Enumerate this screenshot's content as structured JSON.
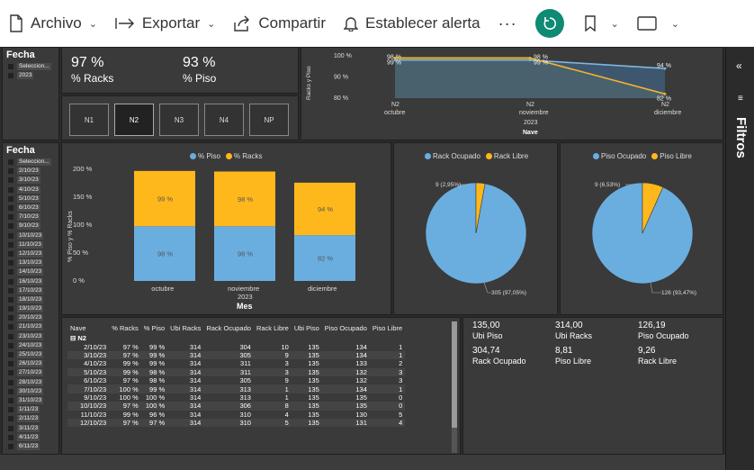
{
  "toolbar": {
    "file_label": "Archivo",
    "export_label": "Exportar",
    "share_label": "Compartir",
    "alert_label": "Establecer alerta",
    "more_label": "···"
  },
  "filters": {
    "label": "Filtros"
  },
  "slicer_top": {
    "title": "Fecha",
    "items": [
      "Seleccion...",
      "2023"
    ]
  },
  "slicer_side": {
    "title": "Fecha",
    "items": [
      "Seleccion...",
      "2/10/23",
      "3/10/23",
      "4/10/23",
      "5/10/23",
      "6/10/23",
      "7/10/23",
      "9/10/23",
      "10/10/23",
      "11/10/23",
      "12/10/23",
      "13/10/23",
      "14/10/23",
      "16/10/23",
      "17/10/23",
      "18/10/23",
      "19/10/23",
      "20/10/23",
      "21/10/23",
      "23/10/23",
      "24/10/23",
      "25/10/23",
      "26/10/23",
      "27/10/23",
      "28/10/23",
      "30/10/23",
      "31/10/23",
      "1/11/23",
      "2/11/23",
      "3/11/23",
      "4/11/23",
      "6/11/23"
    ]
  },
  "kpis": [
    {
      "value": "97 %",
      "label": "% Racks"
    },
    {
      "value": "93 %",
      "label": "% Piso"
    }
  ],
  "nave_buttons": [
    "N1",
    "N2",
    "N3",
    "N4",
    "NP"
  ],
  "selected_nave": "N2",
  "colors": {
    "piso": "#6aaee0",
    "racks": "#ffb81c",
    "line_piso": "#7eb5e0",
    "line_racks": "#f2b230"
  },
  "chart_data": [
    {
      "type": "area",
      "ylabel": "Racks y Piso",
      "xlabel": "Nave",
      "ylim": [
        80,
        100
      ],
      "yticks": [
        "100 %",
        "90 %",
        "80 %"
      ],
      "x_top": [
        "N2",
        "N2",
        "N2"
      ],
      "categories": [
        "octubre",
        "noviembre",
        "diciembre"
      ],
      "year_label": "2023",
      "series": [
        {
          "values": [
            98,
            98,
            94
          ],
          "labels": [
            "98 %",
            "98 %",
            "94 %"
          ]
        },
        {
          "values": [
            99,
            99,
            82
          ],
          "labels": [
            "99 %",
            "99 %",
            "82 %"
          ]
        }
      ]
    },
    {
      "type": "bar",
      "legend": [
        "% Piso",
        "% Racks"
      ],
      "ylabel": "% Piso y % Racks",
      "xlabel": "Mes",
      "year_label": "2023",
      "ylim": [
        0,
        200
      ],
      "yticks": [
        "200 %",
        "150 %",
        "100 %",
        "50 %",
        "0 %"
      ],
      "categories": [
        "octubre",
        "noviembre",
        "diciembre"
      ],
      "series": [
        {
          "name": "% Piso",
          "values": [
            98,
            98,
            82
          ],
          "labels": [
            "98 %",
            "98 %",
            "82 %"
          ]
        },
        {
          "name": "% Racks",
          "values": [
            99,
            98,
            94
          ],
          "labels": [
            "99 %",
            "98 %",
            "94 %"
          ]
        }
      ]
    },
    {
      "type": "pie",
      "legend": [
        "Rack Ocupado",
        "Rack Libre"
      ],
      "slices": [
        {
          "name": "Rack Ocupado",
          "value": 305,
          "label": "305 (97,05%)"
        },
        {
          "name": "Rack Libre",
          "value": 9,
          "label": "9 (2,95%)"
        }
      ]
    },
    {
      "type": "pie",
      "legend": [
        "Piso Ocupado",
        "Piso Libre"
      ],
      "slices": [
        {
          "name": "Piso Ocupado",
          "value": 126,
          "label": "126 (93,47%)"
        },
        {
          "name": "Piso Libre",
          "value": 9,
          "label": "9 (6,53%)"
        }
      ]
    }
  ],
  "table": {
    "headers": [
      "Nave",
      "% Racks",
      "% Piso",
      "Ubi Racks",
      "Rack Ocupado",
      "Rack Libre",
      "Ubi Piso",
      "Piso Ocupado",
      "Piso Libre"
    ],
    "group": "N2",
    "rows": [
      [
        "2/10/23",
        "97 %",
        "99 %",
        "314",
        "304",
        "10",
        "135",
        "134",
        "1"
      ],
      [
        "3/10/23",
        "97 %",
        "99 %",
        "314",
        "305",
        "9",
        "135",
        "134",
        "1"
      ],
      [
        "4/10/23",
        "99 %",
        "99 %",
        "314",
        "311",
        "3",
        "135",
        "133",
        "2"
      ],
      [
        "5/10/23",
        "99 %",
        "98 %",
        "314",
        "311",
        "3",
        "135",
        "132",
        "3"
      ],
      [
        "6/10/23",
        "97 %",
        "98 %",
        "314",
        "305",
        "9",
        "135",
        "132",
        "3"
      ],
      [
        "7/10/23",
        "100 %",
        "99 %",
        "314",
        "313",
        "1",
        "135",
        "134",
        "1"
      ],
      [
        "9/10/23",
        "100 %",
        "100 %",
        "314",
        "313",
        "1",
        "135",
        "135",
        "0"
      ],
      [
        "10/10/23",
        "97 %",
        "100 %",
        "314",
        "306",
        "8",
        "135",
        "135",
        "0"
      ],
      [
        "11/10/23",
        "99 %",
        "96 %",
        "314",
        "310",
        "4",
        "135",
        "130",
        "5"
      ],
      [
        "12/10/23",
        "97 %",
        "97 %",
        "314",
        "310",
        "5",
        "135",
        "131",
        "4"
      ]
    ]
  },
  "cards": [
    {
      "value": "135,00",
      "label": "Ubi Piso"
    },
    {
      "value": "314,00",
      "label": "Ubi Racks"
    },
    {
      "value": "126,19",
      "label": "Piso Ocupado"
    },
    {
      "value": "304,74",
      "label": "Rack Ocupado"
    },
    {
      "value": "8,81",
      "label": "Piso Libre"
    },
    {
      "value": "9,26",
      "label": "Rack Libre"
    }
  ]
}
